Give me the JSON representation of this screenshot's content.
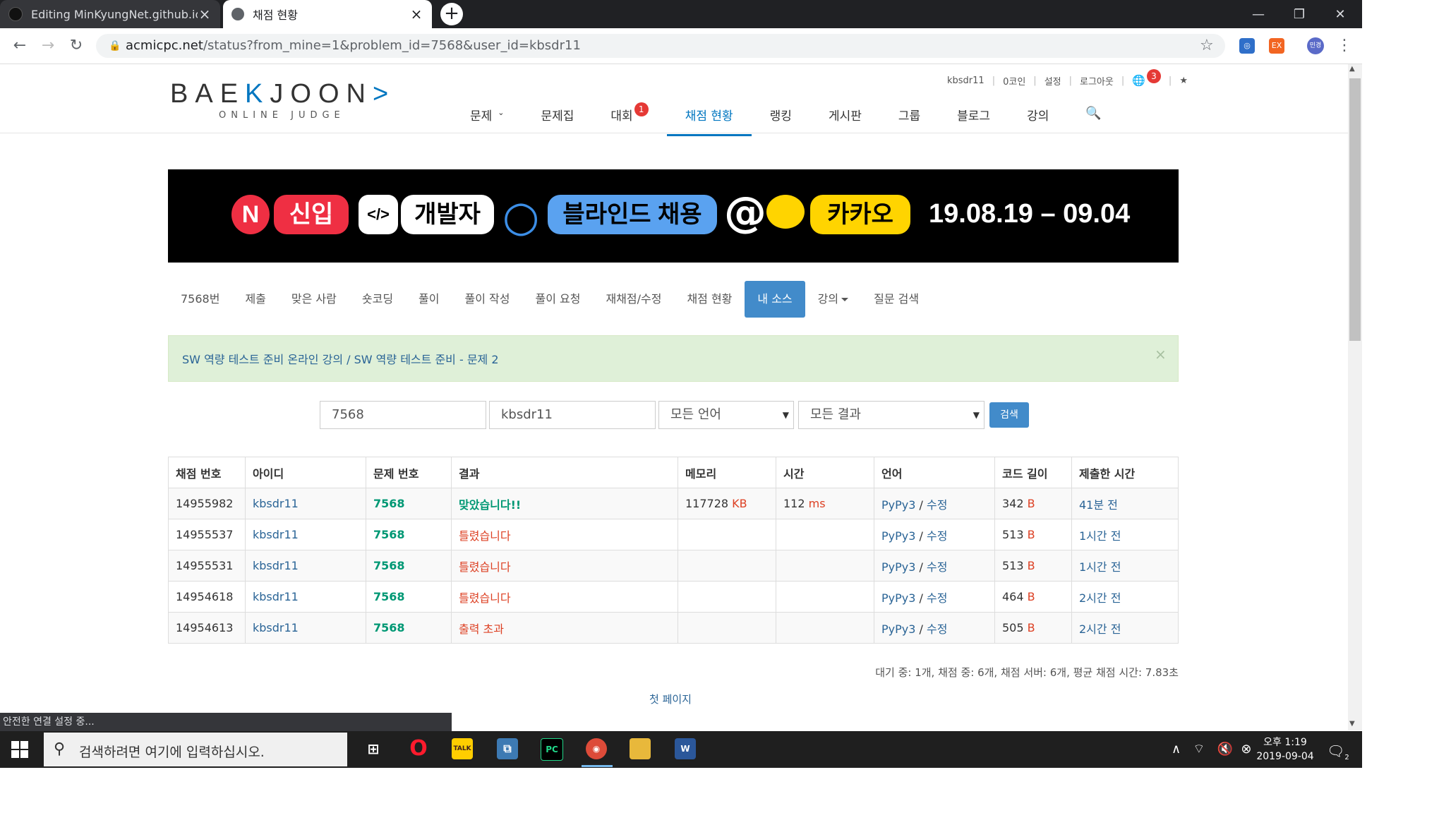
{
  "browser": {
    "tabs": [
      {
        "title": "Editing MinKyungNet.github.io/",
        "active": false
      },
      {
        "title": "채점 현황",
        "active": true
      }
    ],
    "new_tab": "+",
    "window_controls": {
      "minimize": "—",
      "maximize": "❐",
      "close": "✕"
    },
    "url_host": "acmicpc.net",
    "url_rest": "/status?from_mine=1&problem_id=7568&user_id=kbsdr11",
    "profile": "민경",
    "status_text": "안전한 연결 설정 중..."
  },
  "site": {
    "logo_a": "BAE",
    "logo_b": "K",
    "logo_c": "JOON",
    "logo_sub": "ONLINE JUDGE",
    "user_menu": [
      "kbsdr11",
      "0코인",
      "설정",
      "로그아웃"
    ],
    "notification_count": "3",
    "nav": [
      {
        "label": "문제",
        "caret": true
      },
      {
        "label": "문제집"
      },
      {
        "label": "대회",
        "badge": "1"
      },
      {
        "label": "채점 현황",
        "active": true
      },
      {
        "label": "랭킹"
      },
      {
        "label": "게시판"
      },
      {
        "label": "그룹"
      },
      {
        "label": "블로그"
      },
      {
        "label": "강의"
      }
    ]
  },
  "banner": {
    "n": "N",
    "new": "신입",
    "code": "</>",
    "dev": "개발자",
    "blind": "블라인드 채용",
    "at": "@",
    "kakao": "카카오",
    "date": "19.08.19 – 09.04"
  },
  "subtabs": [
    "7568번",
    "제출",
    "맞은 사람",
    "숏코딩",
    "풀이",
    "풀이 작성",
    "풀이 요청",
    "재채점/수정",
    "채점 현황",
    "내 소스",
    "강의",
    "질문 검색"
  ],
  "alert": {
    "course": "SW 역량 테스트 준비 온라인 강의",
    "sep": " / ",
    "problem": "SW 역량 테스트 준비 - 문제 2",
    "close": "×"
  },
  "search": {
    "problem_id": "7568",
    "user_id": "kbsdr11",
    "language": "모든 언어",
    "result": "모든 결과",
    "button": "검색"
  },
  "table": {
    "headers": [
      "채점 번호",
      "아이디",
      "문제 번호",
      "결과",
      "메모리",
      "시간",
      "언어",
      "코드 길이",
      "제출한 시간"
    ],
    "rows": [
      {
        "id": "14955982",
        "user": "kbsdr11",
        "problem": "7568",
        "result": "맞았습니다!!",
        "result_ok": true,
        "memory": "117728",
        "memory_unit": "KB",
        "time": "112",
        "time_unit": "ms",
        "lang": "PyPy3",
        "edit": "수정",
        "length": "342",
        "length_unit": "B",
        "when": "41분 전"
      },
      {
        "id": "14955537",
        "user": "kbsdr11",
        "problem": "7568",
        "result": "틀렸습니다",
        "result_ok": false,
        "memory": "",
        "memory_unit": "",
        "time": "",
        "time_unit": "",
        "lang": "PyPy3",
        "edit": "수정",
        "length": "513",
        "length_unit": "B",
        "when": "1시간 전"
      },
      {
        "id": "14955531",
        "user": "kbsdr11",
        "problem": "7568",
        "result": "틀렸습니다",
        "result_ok": false,
        "memory": "",
        "memory_unit": "",
        "time": "",
        "time_unit": "",
        "lang": "PyPy3",
        "edit": "수정",
        "length": "513",
        "length_unit": "B",
        "when": "1시간 전"
      },
      {
        "id": "14954618",
        "user": "kbsdr11",
        "problem": "7568",
        "result": "틀렸습니다",
        "result_ok": false,
        "memory": "",
        "memory_unit": "",
        "time": "",
        "time_unit": "",
        "lang": "PyPy3",
        "edit": "수정",
        "length": "464",
        "length_unit": "B",
        "when": "2시간 전"
      },
      {
        "id": "14954613",
        "user": "kbsdr11",
        "problem": "7568",
        "result": "출력 초과",
        "result_ok": false,
        "memory": "",
        "memory_unit": "",
        "time": "",
        "time_unit": "",
        "lang": "PyPy3",
        "edit": "수정",
        "length": "505",
        "length_unit": "B",
        "when": "2시간 전"
      }
    ]
  },
  "queue_info": "대기 중: 1개, 채점 중: 6개, 채점 서버: 6개, 평균 채점 시간: 7.83초",
  "first_page": "첫 페이지",
  "taskbar": {
    "search_placeholder": "검색하려면 여기에 입력하십시오.",
    "time": "오후 1:19",
    "date": "2019-09-04",
    "notifications": "2"
  },
  "colors": {
    "accent": "#0076c0",
    "success": "#009874",
    "error": "#dd4124",
    "link": "#2a6496",
    "alert_bg": "#dff0d8"
  }
}
